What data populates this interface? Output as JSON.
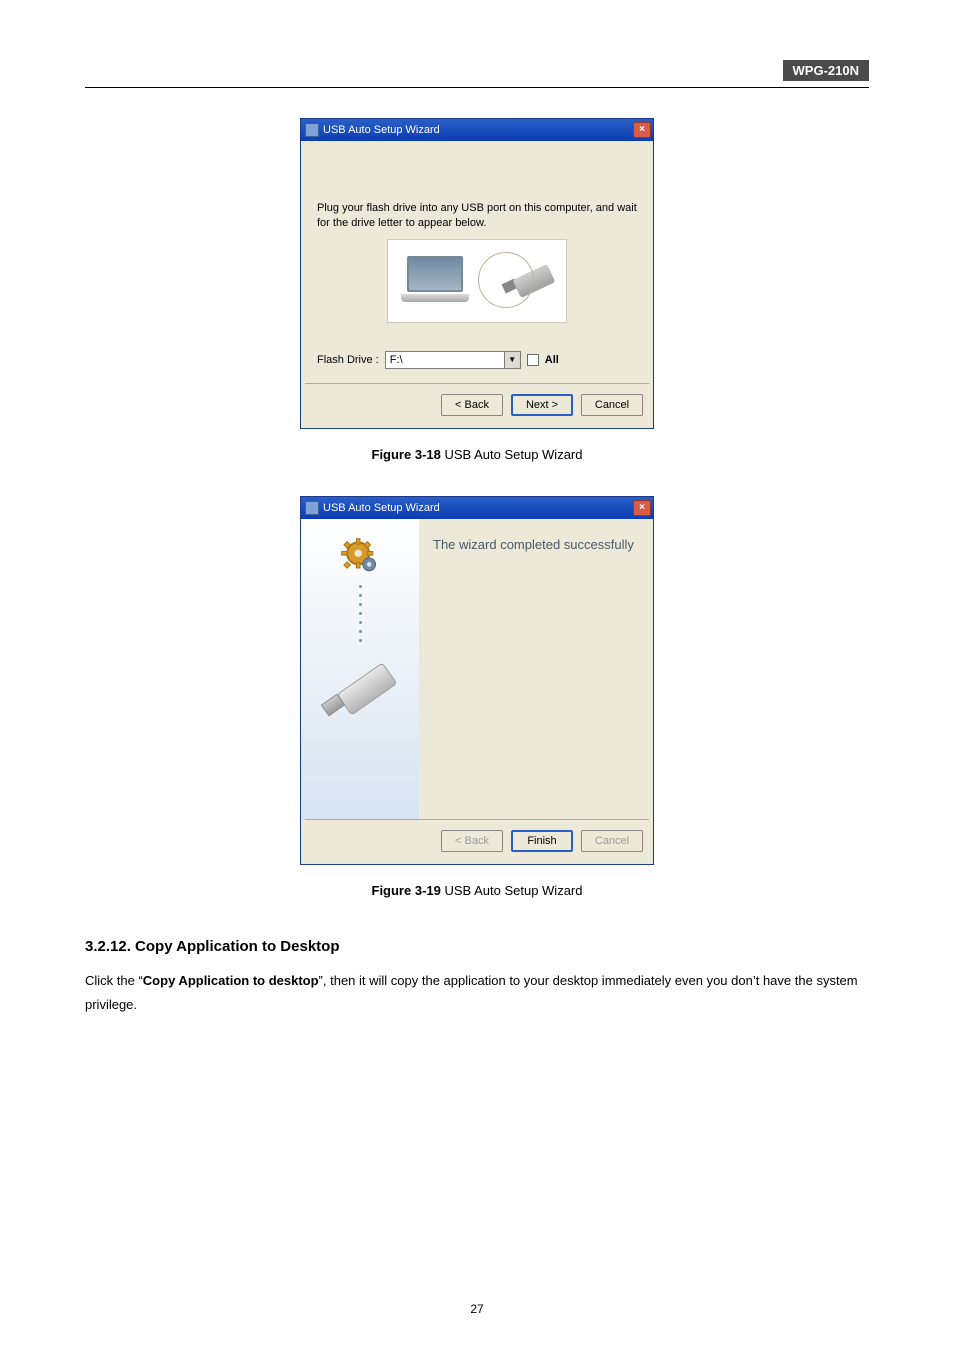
{
  "header": {
    "badge": "WPG-210N"
  },
  "wizard1": {
    "title": "USB Auto Setup Wizard",
    "instruction": "Plug your flash drive into any USB port on this computer, and wait for the drive letter to appear below.",
    "flash_drive_label": "Flash Drive :",
    "flash_drive_value": "F:\\",
    "all_label": "All",
    "buttons": {
      "back": "< Back",
      "next": "Next >",
      "cancel": "Cancel"
    },
    "close_glyph": "×"
  },
  "caption1": {
    "bold": "Figure 3-18",
    "rest": " USB Auto Setup Wizard"
  },
  "wizard2": {
    "title": "USB Auto Setup Wizard",
    "heading": "The wizard completed successfully",
    "buttons": {
      "back": "< Back",
      "finish": "Finish",
      "cancel": "Cancel"
    },
    "close_glyph": "×"
  },
  "caption2": {
    "bold": "Figure 3-19",
    "rest": " USB Auto Setup Wizard"
  },
  "section": {
    "heading": "3.2.12.   Copy Application to Desktop",
    "para_pre": "Click the “",
    "para_bold": "Copy Application to desktop",
    "para_post": "”, then it will copy the application to your desktop immediately even you don’t have the system privilege."
  },
  "page_number": "27"
}
